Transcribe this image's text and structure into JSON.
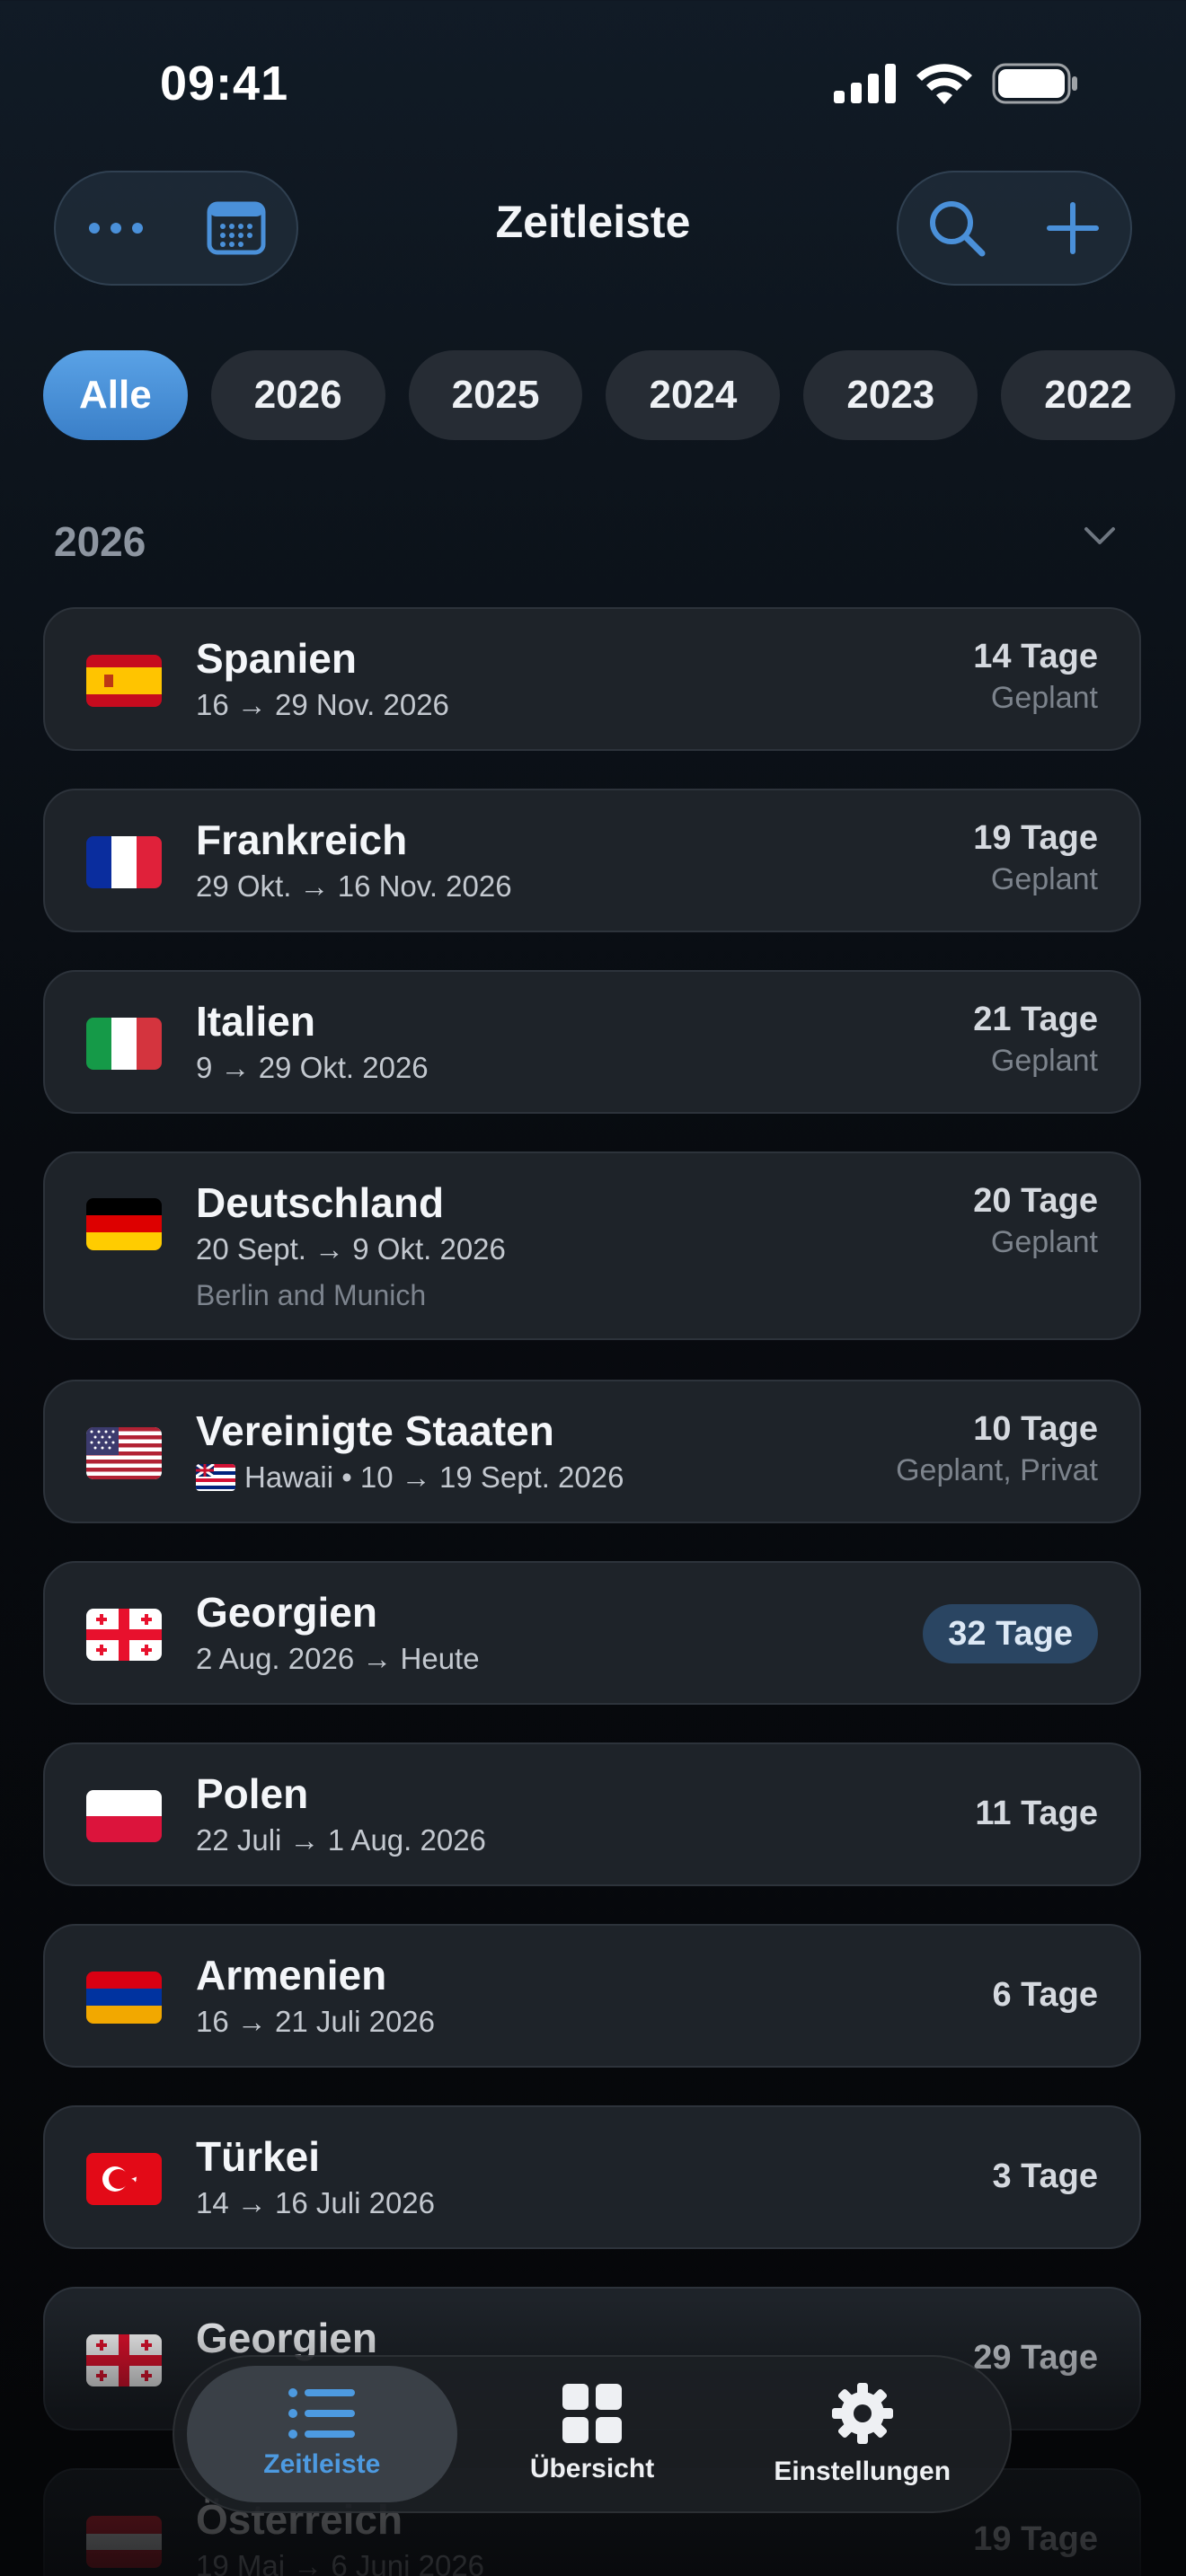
{
  "status_bar": {
    "time": "09:41"
  },
  "header": {
    "title": "Zeitleiste",
    "more_icon": "ellipsis-icon",
    "calendar_icon": "calendar-icon",
    "search_icon": "search-icon",
    "add_icon": "plus-icon"
  },
  "filters": [
    "Alle",
    "2026",
    "2025",
    "2024",
    "2023",
    "2022"
  ],
  "section": {
    "year": "2026"
  },
  "trips": [
    {
      "name": "Spanien",
      "dates": "16 → 29 Nov. 2026",
      "days": "14 Tage",
      "status": "Geplant"
    },
    {
      "name": "Frankreich",
      "dates": "29 Okt. → 16 Nov. 2026",
      "days": "19 Tage",
      "status": "Geplant"
    },
    {
      "name": "Italien",
      "dates": "9 → 29 Okt. 2026",
      "days": "21 Tage",
      "status": "Geplant"
    },
    {
      "name": "Deutschland",
      "dates": "20 Sept. → 9 Okt. 2026",
      "note": "Berlin and Munich",
      "days": "20 Tage",
      "status": "Geplant"
    },
    {
      "name": "Vereinigte Staaten",
      "dates": "Hawaii • 10 → 19 Sept. 2026",
      "days": "10 Tage",
      "status": "Geplant, Privat"
    },
    {
      "name": "Georgien",
      "dates": "2 Aug. 2026 → Heute",
      "days": "32 Tage"
    },
    {
      "name": "Polen",
      "dates": "22 Juli → 1 Aug. 2026",
      "days": "11 Tage"
    },
    {
      "name": "Armenien",
      "dates": "16 → 21 Juli 2026",
      "days": "6 Tage"
    },
    {
      "name": "Türkei",
      "dates": "14 → 16 Juli 2026",
      "days": "3 Tage"
    },
    {
      "name": "Georgien",
      "dates": "",
      "days": "29 Tage"
    },
    {
      "name": "Österreich",
      "dates": "19 Mai → 6 Juni 2026",
      "days": "19 Tage"
    }
  ],
  "tabs": [
    {
      "label": "Zeitleiste",
      "icon": "list-icon"
    },
    {
      "label": "Übersicht",
      "icon": "grid-icon"
    },
    {
      "label": "Einstellungen",
      "icon": "gear-icon"
    }
  ]
}
